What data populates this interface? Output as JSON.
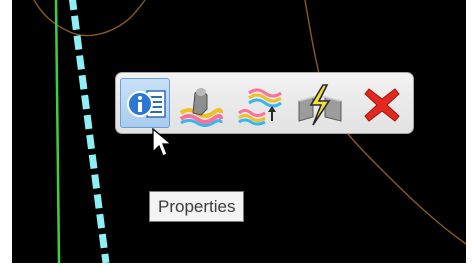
{
  "toolbar": {
    "buttons": [
      {
        "name": "properties",
        "icon": "properties-icon",
        "active": true
      },
      {
        "name": "terrain-model",
        "icon": "terrain-model-icon",
        "active": false
      },
      {
        "name": "layered-surface",
        "icon": "layered-surface-icon",
        "active": false
      },
      {
        "name": "lightning-break",
        "icon": "lightning-break-icon",
        "active": false
      },
      {
        "name": "delete",
        "icon": "delete-icon",
        "active": false
      }
    ]
  },
  "tooltip": {
    "text": "Properties"
  },
  "colors": {
    "background": "#000000",
    "boundary_line": "#8a5a22",
    "green_line": "#3cd13c",
    "dashed_line": "#8ef0f4",
    "toolbar_bg": "#e8e8e8",
    "active_button": "#b9d6f2",
    "delete_red": "#e3281e"
  }
}
